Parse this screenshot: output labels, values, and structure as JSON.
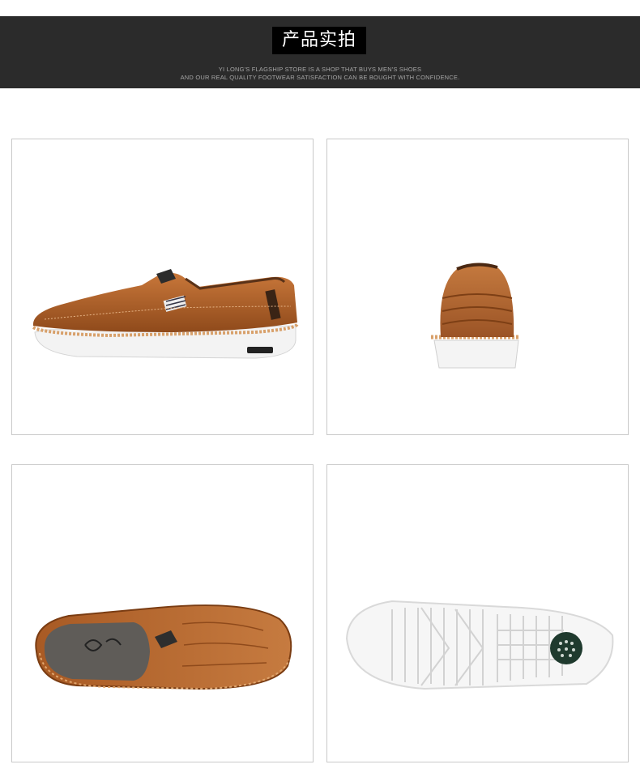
{
  "header": {
    "title": "产品实拍",
    "tagline_line1": "YI LONG'S FLAGSHIP STORE IS A SHOP THAT BUYS MEN'S SHOES",
    "tagline_line2": "AND OUR REAL QUALITY FOOTWEAR SATISFACTION CAN BE BOUGHT WITH CONFIDENCE."
  },
  "photos": [
    {
      "view": "side"
    },
    {
      "view": "back"
    },
    {
      "view": "top"
    },
    {
      "view": "sole"
    }
  ],
  "colors": {
    "banner": "#2b2b2b",
    "leather": "#b5642a",
    "sole": "#f2f2f2",
    "frame": "#c9c9c9"
  }
}
